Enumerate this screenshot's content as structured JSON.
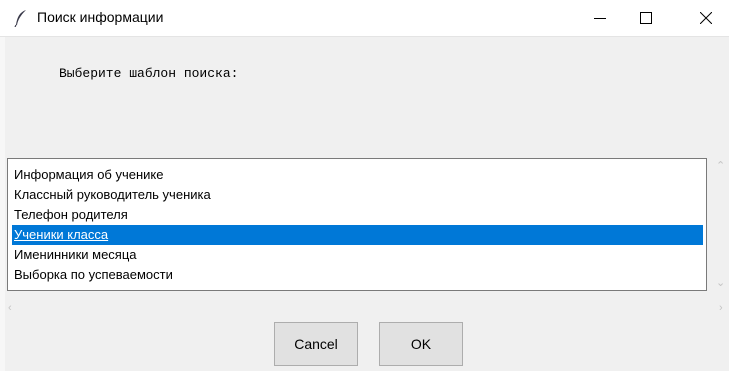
{
  "window": {
    "title": "Поиск информации",
    "icon": "feather-icon"
  },
  "prompt": "Выберите шаблон поиска:",
  "list": {
    "items": [
      "Информация об ученике",
      "Классный руководитель ученика",
      "Телефон родителя",
      "Ученики класса",
      "Именинники месяца",
      "Выборка по успеваемости"
    ],
    "selected_index": 3,
    "selection_color": "#0078d7"
  },
  "buttons": {
    "cancel": "Cancel",
    "ok": "OK"
  }
}
